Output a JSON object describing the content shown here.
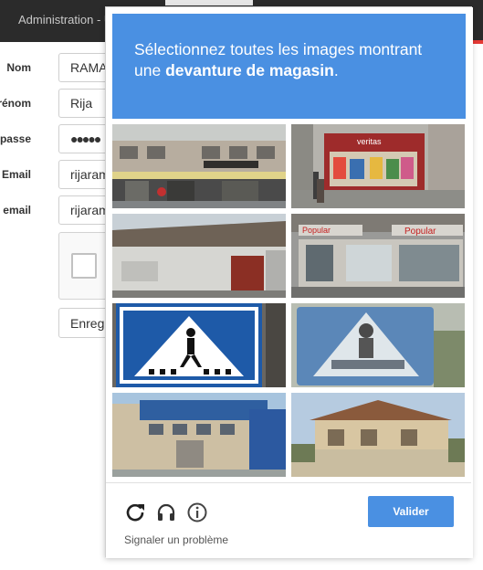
{
  "background_page": {
    "header_title": "Administration - U",
    "form": {
      "fields": [
        {
          "label": "Nom",
          "value": "RAMA"
        },
        {
          "label": "Prénom",
          "value": "Rija"
        },
        {
          "label": "Mot de passe",
          "value": "●●●●●"
        },
        {
          "label": "Email",
          "value": "rijaram"
        },
        {
          "label": "Confirmation email",
          "value": "rijaram"
        }
      ],
      "submit_label": "Enregi"
    }
  },
  "challenge": {
    "instruction_prefix": "Sélectionnez toutes les images montrant une",
    "instruction_target": "devanture de magasin",
    "instruction_suffix": ".",
    "tiles": [
      {
        "subject": "storefront-street"
      },
      {
        "subject": "storefront-veritas",
        "sign": "veritas"
      },
      {
        "subject": "old-building-red-door"
      },
      {
        "subject": "storefront-popular",
        "sign_left": "Popular",
        "sign_right": "Popular"
      },
      {
        "subject": "pedestrian-crossing-sign"
      },
      {
        "subject": "pedestrian-crossing-sign-blurred"
      },
      {
        "subject": "blue-industrial-building"
      },
      {
        "subject": "beige-house"
      }
    ],
    "icons": [
      "reload-icon",
      "audio-icon",
      "info-icon"
    ],
    "verify_label": "Valider",
    "report_label": "Signaler un problème",
    "accent_color": "#4a90e2"
  }
}
